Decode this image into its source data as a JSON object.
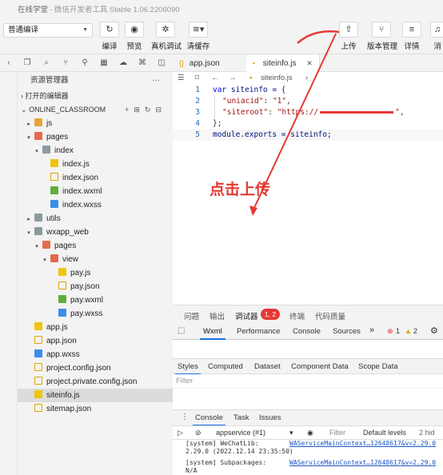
{
  "window": {
    "title": "在线学堂",
    "subtitle": "- 微信开发者工具 Stable 1.06.2206090"
  },
  "toolbar": {
    "mode": "普通编译",
    "buttons": [
      {
        "label": "编译",
        "icon": "refresh-icon"
      },
      {
        "label": "预览",
        "icon": "eye-icon"
      },
      {
        "label": "真机调试",
        "icon": "bug-icon"
      },
      {
        "label": "清缓存",
        "icon": "layers-icon"
      },
      {
        "label": "上传",
        "icon": "upload-icon"
      },
      {
        "label": "版本管理",
        "icon": "branch-icon"
      },
      {
        "label": "详情",
        "icon": "menu-icon"
      },
      {
        "label": "消",
        "icon": "bell-icon"
      }
    ]
  },
  "explorer": {
    "title": "资源管理器",
    "open_editors": "打开的编辑器",
    "project": "ONLINE_CLASSROOM",
    "tree": [
      {
        "label": "js",
        "type": "folder",
        "depth": 1,
        "open": false
      },
      {
        "label": "pages",
        "type": "folder-red",
        "depth": 1,
        "open": true
      },
      {
        "label": "index",
        "type": "folder-green",
        "depth": 2,
        "open": true
      },
      {
        "label": "index.js",
        "type": "js",
        "depth": 3
      },
      {
        "label": "index.json",
        "type": "json",
        "depth": 3
      },
      {
        "label": "index.wxml",
        "type": "wxml",
        "depth": 3
      },
      {
        "label": "index.wxss",
        "type": "wxss",
        "depth": 3
      },
      {
        "label": "utils",
        "type": "folder-green",
        "depth": 1,
        "open": false
      },
      {
        "label": "wxapp_web",
        "type": "folder-green",
        "depth": 1,
        "open": true
      },
      {
        "label": "pages",
        "type": "folder-red",
        "depth": 2,
        "open": true
      },
      {
        "label": "view",
        "type": "folder-red",
        "depth": 3,
        "open": true
      },
      {
        "label": "pay.js",
        "type": "js",
        "depth": 4
      },
      {
        "label": "pay.json",
        "type": "json",
        "depth": 4
      },
      {
        "label": "pay.wxml",
        "type": "wxml",
        "depth": 4
      },
      {
        "label": "pay.wxss",
        "type": "wxss",
        "depth": 4
      },
      {
        "label": "app.js",
        "type": "js",
        "depth": 1
      },
      {
        "label": "app.json",
        "type": "json",
        "depth": 1
      },
      {
        "label": "app.wxss",
        "type": "wxss",
        "depth": 1
      },
      {
        "label": "project.config.json",
        "type": "json",
        "depth": 1
      },
      {
        "label": "project.private.config.json",
        "type": "json",
        "depth": 1
      },
      {
        "label": "siteinfo.js",
        "type": "js",
        "depth": 1,
        "selected": true
      },
      {
        "label": "sitemap.json",
        "type": "json",
        "depth": 1
      }
    ]
  },
  "editor": {
    "tabs": [
      {
        "label": "app.json"
      },
      {
        "label": "siteinfo.js",
        "active": true
      }
    ],
    "breadcrumb": "siteinfo.js",
    "annotation": "点击上传",
    "lines": [
      {
        "n": "1"
      },
      {
        "n": "2"
      },
      {
        "n": "3"
      },
      {
        "n": "4"
      },
      {
        "n": "5"
      }
    ],
    "code": {
      "l1_kw": "var",
      "l1_rest": " siteinfo = {",
      "l2_key": "\"uniacid\"",
      "l2_val": "\"1\"",
      "l3_key": "\"siteroot\"",
      "l3_val": "\"https://",
      "l4": "};",
      "l5_a": "module.exports",
      "l5_b": " = siteinfo;"
    }
  },
  "panel": {
    "tabs": [
      "问题",
      "输出",
      "调试器",
      "终端",
      "代码质量"
    ],
    "badge": "1, 2",
    "devtools_tabs": [
      "Wxml",
      "Performance",
      "Console",
      "Sources"
    ],
    "errors": "1",
    "warnings": "2",
    "styles_tabs": [
      "Styles",
      "Computed",
      "Dataset",
      "Component Data",
      "Scope Data"
    ],
    "filter_placeholder": "Filter",
    "console_tabs": [
      "Console",
      "Task",
      "Issues"
    ],
    "context": "appservice (#1)",
    "filter2": "Filter",
    "levels": "Default levels",
    "hidden": "2 hid",
    "log": {
      "r1": "[system] WeChatLib:",
      "r1_link": "WAServiceMainContext…12648617&v=2.29.0",
      "r2": "2.29.0 (2022.12.14 23:35:50)",
      "r3": "[system] Subpackages:",
      "r3_link": "WAServiceMainContext…12648617&v=2.29.0",
      "r4": "N/A"
    }
  },
  "colors": {
    "accent": "#1a73e8",
    "annotation": "#e53935"
  }
}
